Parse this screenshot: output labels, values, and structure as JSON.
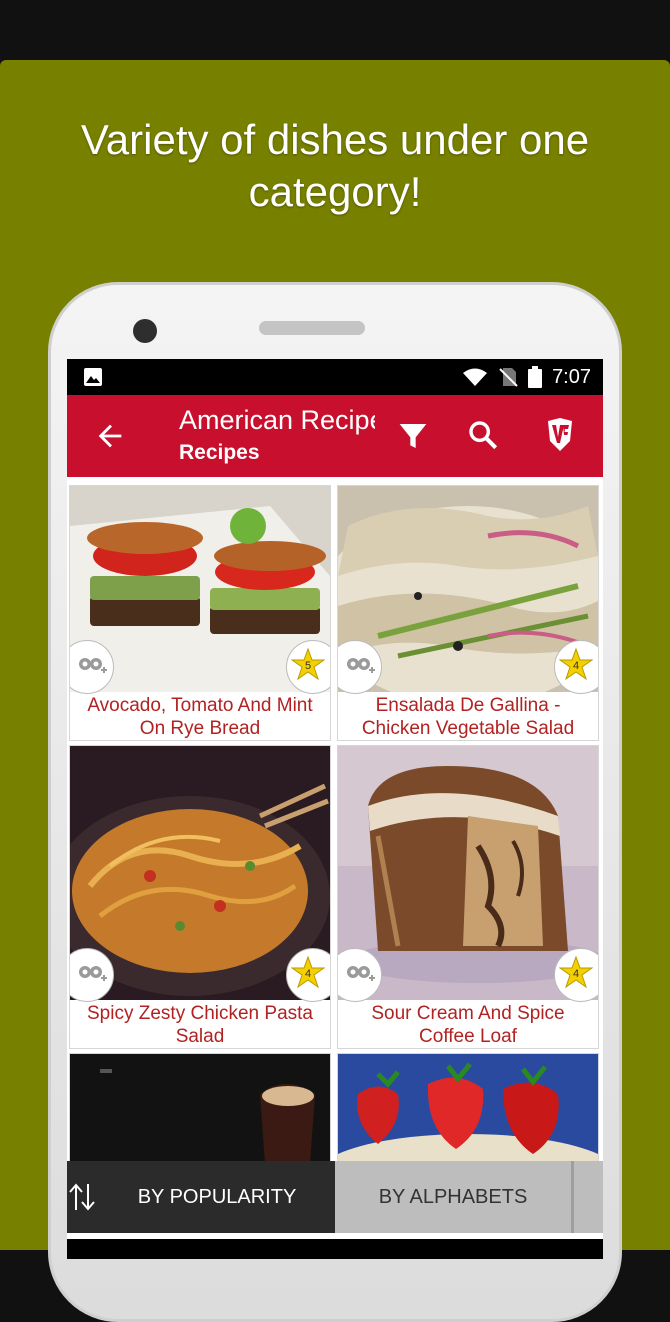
{
  "promo": {
    "line1": "Variety of dishes under one",
    "line2": "category!"
  },
  "status_bar": {
    "time": "7:07"
  },
  "app_bar": {
    "title": "American Recipes",
    "subtitle": "Recipes"
  },
  "recipes": [
    {
      "title_line1": "Avocado, Tomato And Mint",
      "title_line2": "On Rye Bread",
      "rating": "5"
    },
    {
      "title_line1": "Ensalada De Gallina -",
      "title_line2": "Chicken Vegetable Salad",
      "rating": "4"
    },
    {
      "title_line1": "Spicy Zesty Chicken Pasta",
      "title_line2": "Salad",
      "rating": "4"
    },
    {
      "title_line1": "Sour Cream And Spice",
      "title_line2": "Coffee Loaf",
      "rating": "4"
    }
  ],
  "sort": {
    "by_popularity": "BY POPULARITY",
    "by_alphabets": "BY ALPHABETS"
  },
  "colors": {
    "promo_bg": "#788000",
    "app_bar": "#c8102e",
    "caption": "#b22222",
    "star": "#f5d000"
  }
}
